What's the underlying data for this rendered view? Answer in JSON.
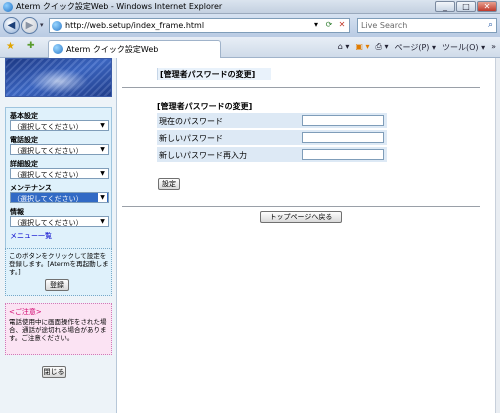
{
  "window": {
    "title": "Aterm クイック設定Web - Windows Internet Explorer",
    "minimize": "_",
    "maximize": "□",
    "close": "✕"
  },
  "addressbar": {
    "url": "http://web.setup/index_frame.html",
    "search_placeholder": "Live Search"
  },
  "tab": {
    "label": "Aterm クイック設定Web"
  },
  "toolbar": {
    "home_icon": "home-icon",
    "feeds_icon": "feeds-icon",
    "print_icon": "print-icon",
    "page_label": "ページ(P) ▾",
    "tools_label": "ツール(O) ▾"
  },
  "sidebar": {
    "categories": [
      {
        "label": "基本設定",
        "selected": "（選択してください）"
      },
      {
        "label": "電話設定",
        "selected": "（選択してください）"
      },
      {
        "label": "詳細設定",
        "selected": "（選択してください）"
      },
      {
        "label": "メンテナンス",
        "selected": "（選択してください）"
      },
      {
        "label": "情報",
        "selected": "（選択してください）"
      }
    ],
    "menu_link": "メニュー一覧",
    "info_text": "このボタンをクリックして設定を登録します。[Atermを再起動します。]",
    "register_button": "登録",
    "caution_title": "<ご注意>",
    "caution_text": "電話使用中に画面操作をされた場合、通話が途切れる場合があります。ご注意ください。",
    "close_button": "閉じる"
  },
  "main": {
    "heading": "[管理者パスワードの変更]",
    "section_title": "[管理者パスワードの変更]",
    "fields": [
      {
        "label": "現在のパスワード",
        "value": ""
      },
      {
        "label": "新しいパスワード",
        "value": ""
      },
      {
        "label": "新しいパスワード再入力",
        "value": ""
      }
    ],
    "set_button": "設定",
    "top_button": "トップページへ戻る"
  },
  "colors": {
    "selected_menu": "#316ac5",
    "caution_title": "#d0006c",
    "link": "#0000cc"
  }
}
